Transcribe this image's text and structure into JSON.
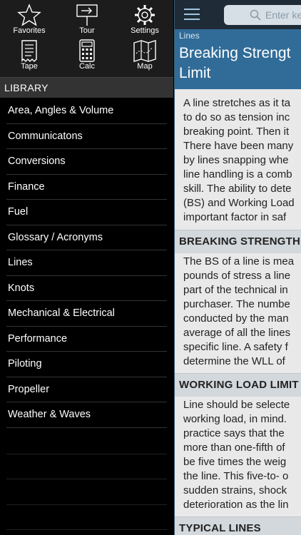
{
  "toolbar": {
    "items": [
      {
        "label": "Favorites",
        "icon": "star-icon"
      },
      {
        "label": "Tour",
        "icon": "signpost-icon"
      },
      {
        "label": "Settings",
        "icon": "gear-icon"
      },
      {
        "label": "Tape",
        "icon": "receipt-tape-icon"
      },
      {
        "label": "Calc",
        "icon": "calculator-icon"
      },
      {
        "label": "Map",
        "icon": "map-icon"
      }
    ]
  },
  "library": {
    "header": "LIBRARY",
    "items": [
      "Area, Angles & Volume",
      "Communicatons",
      "Conversions",
      "Finance",
      "Fuel",
      "Glossary / Acronyms",
      "Lines",
      "Knots",
      "Mechanical & Electrical",
      "Performance",
      "Piloting",
      "Propeller",
      "Weather & Waves"
    ]
  },
  "search": {
    "placeholder": "Enter ke"
  },
  "article": {
    "breadcrumb": "Lines",
    "title_line1": "Breaking Strengt",
    "title_line2": "Limit",
    "intro": [
      "A line stretches as it ta",
      "to do so as tension inc",
      "breaking point. Then it",
      "There have been many",
      "by lines snapping whe",
      "line handling is a comb",
      "skill. The ability to dete",
      "(BS) and Working Load",
      "important factor in saf"
    ],
    "sections": [
      {
        "heading": "BREAKING STRENGTH",
        "lines": [
          "The BS of a line is mea",
          "pounds of stress a line",
          "part of the technical in",
          "purchaser. The numbe",
          "conducted by the man",
          "average of all the lines",
          "specific line. A safety f",
          "determine the WLL of"
        ]
      },
      {
        "heading": "WORKING LOAD LIMIT",
        "lines": [
          "Line should be selecte",
          "working load, in mind.",
          "practice says that the",
          "more than one-fifth of",
          "be five times the weig",
          "the line. This five-to- o",
          "sudden strains, shock",
          "deterioration as the lin"
        ]
      },
      {
        "heading": "TYPICAL LINES",
        "lines": []
      }
    ]
  },
  "colors": {
    "title_area": "#316c98",
    "topbar": "#1f2c38",
    "content_bg": "#e9e9e9",
    "section_bar": "#d3d8dc"
  }
}
